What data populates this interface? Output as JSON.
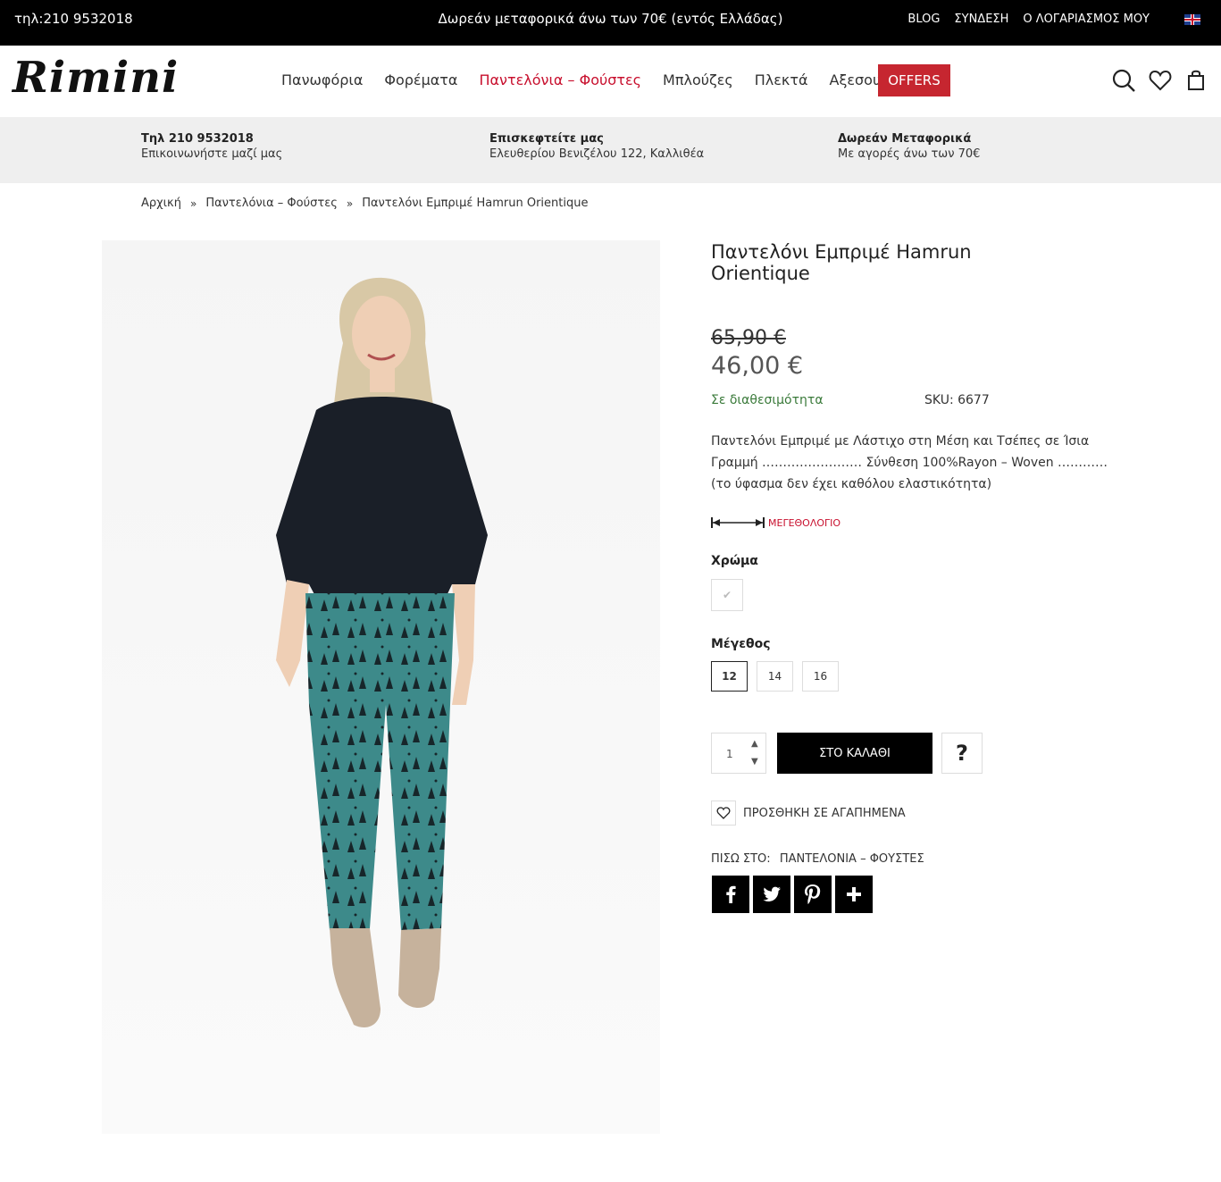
{
  "topbar": {
    "phone": "τηλ:210 9532018",
    "promo": "Δωρεάν μεταφορικά άνω των 70€ (εντός Ελλάδας)",
    "links": [
      "BLOG",
      "ΣΥΝΔΕΣΗ",
      "Ο ΛΟΓΑΡΙΑΣΜΟΣ ΜΟΥ"
    ],
    "language": "english-flag-icon"
  },
  "header": {
    "logo": "Rimini",
    "nav": [
      "Πανωφόρια",
      "Φορέματα",
      "Παντελόνια – Φούστες",
      "Μπλούζες",
      "Πλεκτά",
      "Αξεσουάρ"
    ],
    "active_nav": "Παντελόνια – Φούστες",
    "offers": "OFFERS",
    "icons": [
      "search-icon",
      "heart-icon",
      "bag-icon"
    ],
    "accent_color": "#c62630"
  },
  "infobar": {
    "items": [
      {
        "title": "Τηλ 210 9532018",
        "sub": "Επικοινωνήστε μαζί μας"
      },
      {
        "title": "Επισκεφτείτε μας",
        "sub": "Ελευθερίου Βενιζέλου 122, Καλλιθέα"
      },
      {
        "title": "Δωρεάν Μεταφορικά",
        "sub": "Με αγορές άνω των 70€"
      }
    ]
  },
  "breadcrumb": [
    "Αρχική",
    "Παντελόνια – Φούστες",
    "Παντελόνι Εμπριμέ Hamrun Orientique"
  ],
  "product": {
    "title": "Παντελόνι Εμπριμέ Hamrun Orientique",
    "old_price": "65,90 €",
    "price": "46,00 €",
    "stock": "Σε διαθεσιμότητα",
    "sku": "SKU: 6677",
    "description": "Παντελόνι Εμπριμέ με Λάστιχο στη Μέση και Τσέπες σε Ίσια Γραμμή …………………… Σύνθεση 100%Rayon – Woven ………… (το ύφασμα δεν έχει καθόλου ελαστικότητα)",
    "size_guide": "ΜΕΓΕΘΟΛΟΓΙΟ",
    "color_label": "Χρώμα",
    "size_label": "Μέγεθος",
    "sizes": [
      "12",
      "14",
      "16"
    ],
    "selected_size": "12",
    "quantity": "1",
    "add_to_cart": "ΣΤΟ ΚΑΛΑΘΙ",
    "ask": "?",
    "wishlist": "ΠΡΟΣΘΗΚΗ ΣΕ ΑΓΑΠΗΜΕΝΑ",
    "back_label": "ΠΙΣΩ ΣΤΟ:",
    "back_category": "ΠΑΝΤΕΛΟΝΙΑ – ΦΟΥΣΤΕΣ",
    "share": [
      "facebook-icon",
      "twitter-icon",
      "pinterest-icon",
      "plus-icon"
    ],
    "price_color": "#555555",
    "stock_color": "#3a7a3a"
  }
}
